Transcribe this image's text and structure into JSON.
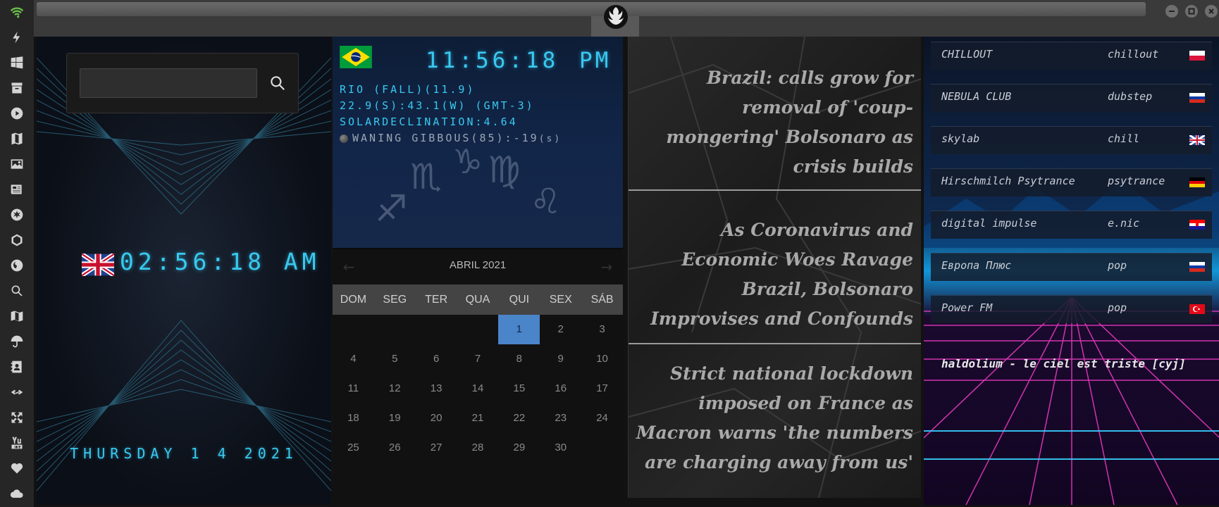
{
  "rail": {
    "icons": [
      "wifi-icon",
      "bolt-icon",
      "windows-icon",
      "archive-icon",
      "play-icon",
      "map-book-icon",
      "image-icon",
      "news-icon",
      "settings-icon",
      "hexagon-icon",
      "globe-icon",
      "search-icon",
      "map-icon",
      "umbrella-icon",
      "contacts-icon",
      "link-icon",
      "expand-icon",
      "youtube-icon",
      "heart-icon",
      "cloud-icon"
    ],
    "accent": "#6cc04a"
  },
  "local_clock": {
    "search_placeholder": "",
    "time": "02:56:18 AM",
    "date": "THURSDAY 1 4 2021"
  },
  "world_clock": {
    "time": "11:56:18",
    "ampm": "PM",
    "line1": "RIO (FALL)(11.9)",
    "line2": "22.9(S):43.1(W) (GMT-3)",
    "line3": "SOLARDECLINATION:4.64",
    "moon": "WANING GIBBOUS(85):-19",
    "moon_unit": "(s)"
  },
  "calendar": {
    "prev": "←",
    "next": "→",
    "title": "ABRIL 2021",
    "days_of_week": [
      "DOM",
      "SEG",
      "TER",
      "QUA",
      "QUI",
      "SEX",
      "SÁB"
    ],
    "leading_blanks": 4,
    "days": [
      "1",
      "2",
      "3",
      "4",
      "5",
      "6",
      "7",
      "8",
      "9",
      "10",
      "11",
      "12",
      "13",
      "14",
      "15",
      "16",
      "17",
      "18",
      "19",
      "20",
      "21",
      "22",
      "23",
      "24",
      "25",
      "26",
      "27",
      "28",
      "29",
      "30"
    ],
    "today": "1",
    "today_color": "#4a84c9"
  },
  "news": [
    {
      "headline": "Brazil: calls grow for removal of 'coup-mongering' Bolsonaro as crisis builds"
    },
    {
      "headline": "As Coronavirus and Economic Woes Ravage Brazil, Bolsonaro Improvises and Confounds"
    },
    {
      "headline": "Strict national lockdown imposed on France as Macron warns 'the numbers are charging away from us'"
    }
  ],
  "radio": {
    "stations": [
      {
        "name": "CHILLOUT",
        "genre": "chillout",
        "flag": "poland"
      },
      {
        "name": "NEBULA CLUB",
        "genre": "dubstep",
        "flag": "russia"
      },
      {
        "name": "skylab",
        "genre": "chill",
        "flag": "uk"
      },
      {
        "name": "Hirschmilch Psytrance",
        "genre": "psytrance",
        "flag": "germany"
      },
      {
        "name": "digital impulse",
        "genre": "e.nic",
        "flag": "croatia"
      },
      {
        "name": "Европа Плюс",
        "genre": "pop",
        "flag": "russia"
      },
      {
        "name": "Power FM",
        "genre": "pop",
        "flag": "turkey"
      }
    ],
    "now_playing": "haldolium - le ciel est triste [cyj]"
  }
}
